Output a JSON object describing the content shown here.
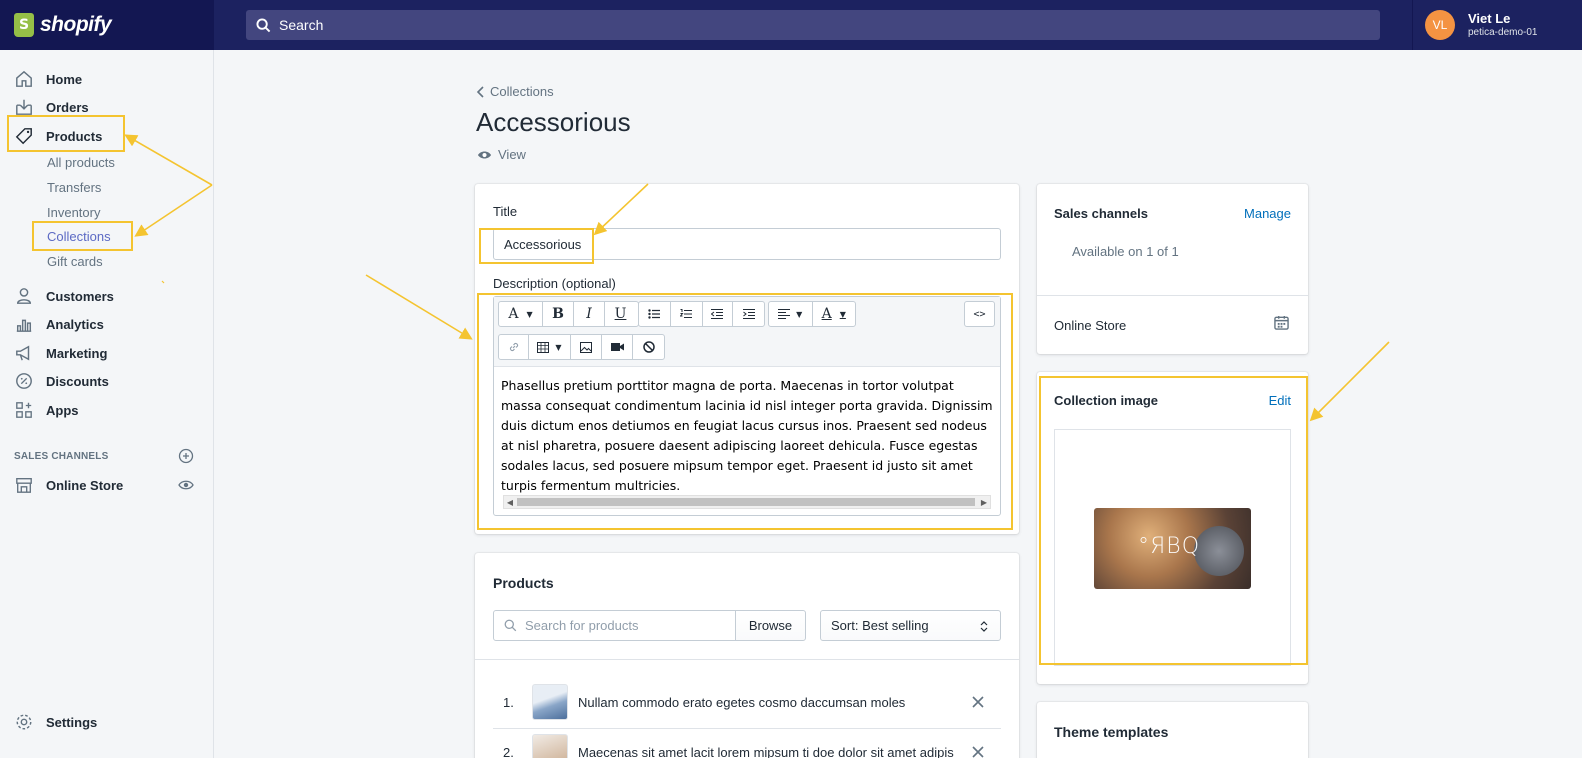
{
  "topbar": {
    "logo_text": "shopify",
    "search_placeholder": "Search",
    "user": {
      "initials": "VL",
      "name": "Viet Le",
      "store": "petica-demo-01"
    }
  },
  "sidebar": {
    "home": "Home",
    "orders": "Orders",
    "products": "Products",
    "sub": {
      "all_products": "All products",
      "transfers": "Transfers",
      "inventory": "Inventory",
      "collections": "Collections",
      "gift_cards": "Gift cards"
    },
    "customers": "Customers",
    "analytics": "Analytics",
    "marketing": "Marketing",
    "discounts": "Discounts",
    "apps": "Apps",
    "sales_channels_label": "SALES CHANNELS",
    "online_store": "Online Store",
    "settings": "Settings"
  },
  "page": {
    "breadcrumb": "Collections",
    "title": "Accessorious",
    "view_label": "View"
  },
  "main_card": {
    "title_label": "Title",
    "title_value": "Accessorious",
    "description_label": "Description (optional)",
    "description_text": "Phasellus pretium porttitor magna de porta. Maecenas in tortor volutpat massa consequat condimentum lacinia id nisl integer porta gravida. Dignissim duis dictum enos detiumos en feugiat lacus cursus inos. Praesent sed nodeus at nisl pharetra, posuere daesent adipiscing laoreet dehicula. Fusce egestas sodales lacus, sed posuere mipsum tempor eget. Praesent id justo sit amet turpis fermentum multricies.",
    "toolbar": {
      "font": "A",
      "bold": "B",
      "italic": "I",
      "underline": "U",
      "color": "A",
      "code": "<>"
    }
  },
  "products_card": {
    "title": "Products",
    "search_placeholder": "Search for products",
    "browse_label": "Browse",
    "sort_label": "Sort: Best selling",
    "items": [
      {
        "index": "1.",
        "name": "Nullam commodo erato egetes cosmo daccumsan moles"
      },
      {
        "index": "2.",
        "name": "Maecenas sit amet lacit lorem mipsum ti doe dolor sit amet adipis"
      }
    ]
  },
  "sales_card": {
    "title": "Sales channels",
    "manage_label": "Manage",
    "availability": "Available on 1 of 1",
    "channel": "Online Store"
  },
  "image_card": {
    "title": "Collection image",
    "edit_label": "Edit",
    "image_watermark": "°ЯBQ"
  },
  "theme_card": {
    "title": "Theme templates"
  },
  "colors": {
    "topbar": "#1c2260",
    "accent": "#5c6ac4",
    "link": "#006fbb",
    "annotation": "#f4c430",
    "avatar": "#f49342"
  }
}
